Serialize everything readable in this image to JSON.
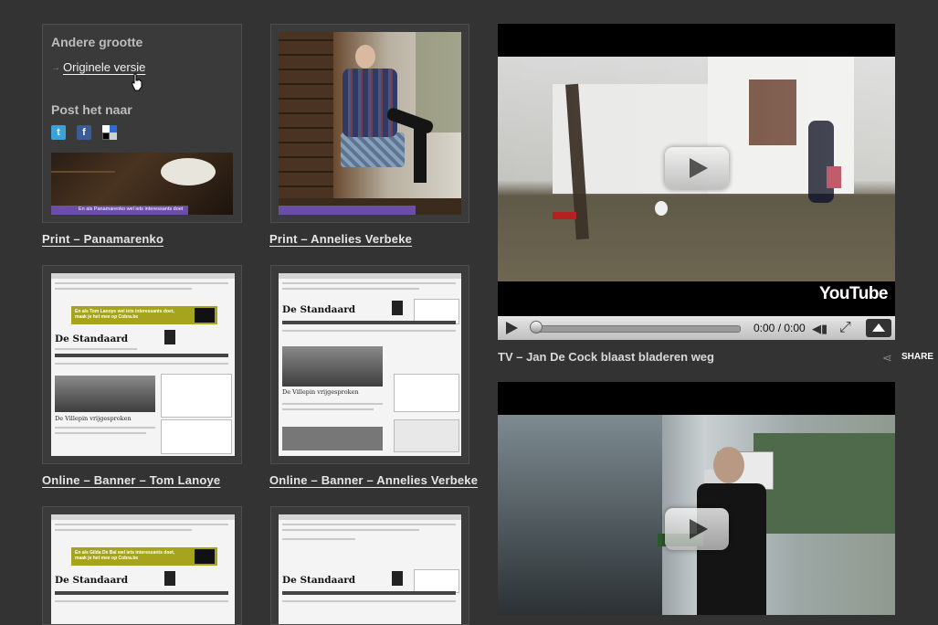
{
  "popup": {
    "heading_size": "Andere grootte",
    "original_link": "Originele versie",
    "heading_post": "Post het naar",
    "social": [
      "twitter-icon",
      "facebook-icon",
      "delicious-icon"
    ]
  },
  "items": [
    {
      "caption": "Print – Panamarenko",
      "banner_text": "En als Panamarenko wel iets interessants doet"
    },
    {
      "caption": "Print – Annelies Verbeke"
    },
    {
      "caption": "Online – Banner – Tom Lanoye",
      "site": "De Standaard",
      "ad": "En als Tom Lanoye wel iets interessants doet, maak je het mee op Cobra.be",
      "headline": "De Villepin vrijgesproken"
    },
    {
      "caption": "Online – Banner – Annelies Verbeke",
      "site": "De Standaard",
      "headline": "De Villepin vrijgesproken"
    },
    {
      "caption": "",
      "site": "De Standaard",
      "ad": "En als Gilda De Bal wel iets interessants doet, maak je het mee op Cobra.be"
    },
    {
      "caption": "",
      "site": "De Standaard"
    }
  ],
  "videos": [
    {
      "title": "TV – Jan De Cock blaast bladeren weg",
      "time": "0:00 / 0:00",
      "brand": "YouTube",
      "share": "SHARE"
    },
    {
      "title": ""
    }
  ]
}
